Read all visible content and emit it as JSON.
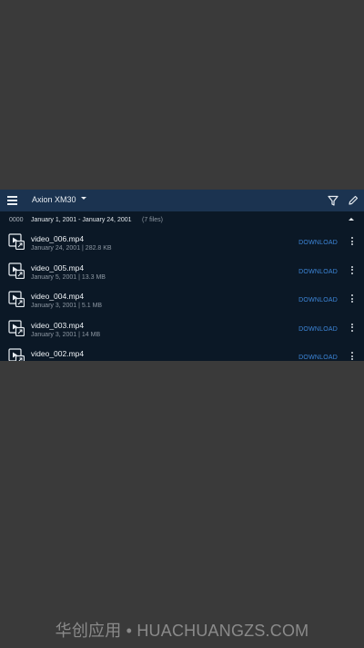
{
  "appbar": {
    "title": "Axion XM30",
    "icons": [
      "menu-icon",
      "dropdown-caret-icon",
      "filter-icon",
      "edit-icon"
    ]
  },
  "group": {
    "id": "0000",
    "range": "January 1, 2001 - January 24, 2001",
    "count": "(7 files)"
  },
  "files": [
    {
      "name": "video_006.mp4",
      "meta": "January 24, 2001 | 282.8 KB",
      "action": "DOWNLOAD"
    },
    {
      "name": "video_005.mp4",
      "meta": "January 5, 2001 | 13.3 MB",
      "action": "DOWNLOAD"
    },
    {
      "name": "video_004.mp4",
      "meta": "January 3, 2001 | 5.1 MB",
      "action": "DOWNLOAD"
    },
    {
      "name": "video_003.mp4",
      "meta": "January 3, 2001 | 14 MB",
      "action": "DOWNLOAD"
    },
    {
      "name": "video_002.mp4",
      "meta": "",
      "action": "DOWNLOAD"
    }
  ],
  "watermark": "华创应用 • HUACHUANGZS.COM",
  "colors": {
    "appbar": "#1b3350",
    "panel": "#0b1826",
    "accent": "#3d86d9",
    "backdrop": "#3a3a3a"
  }
}
